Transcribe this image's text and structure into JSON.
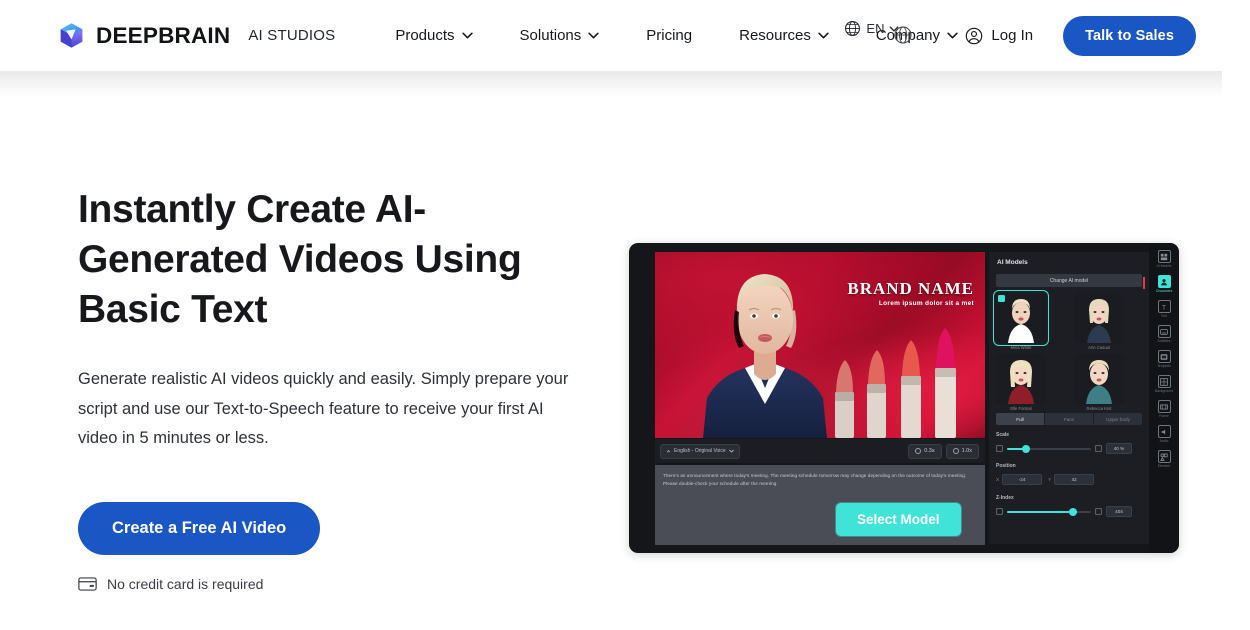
{
  "brand": {
    "logo_icon": "cube-logo-icon",
    "name": "DEEPBRAIN",
    "sub": "AI STUDIOS",
    "accent": "#1A56C4"
  },
  "nav": {
    "items": [
      {
        "label": "Products",
        "has_chevron": true,
        "icon": "chevron-down-icon"
      },
      {
        "label": "Solutions",
        "has_chevron": true,
        "icon": "chevron-down-icon"
      },
      {
        "label": "Pricing",
        "has_chevron": false,
        "icon": ""
      },
      {
        "label": "Resources",
        "has_chevron": true,
        "icon": "chevron-down-icon"
      },
      {
        "label": "Company",
        "has_chevron": true,
        "icon": "chevron-down-icon"
      }
    ]
  },
  "header_right": {
    "language": {
      "icon": "globe-icon",
      "label": "EN",
      "chevron": "chevron-down-icon"
    },
    "login": {
      "icon": "user-circle-icon",
      "label": "Log In"
    },
    "cta": {
      "label": "Talk to Sales",
      "color": "#1A56C4"
    }
  },
  "hero": {
    "title": "Instantly Create AI-Generated Videos Using Basic Text",
    "subtitle": "Generate realistic AI videos quickly and easily. Simply prepare your script and use our Text-to-Speech feature to receive your first AI video in 5 minutes or less.",
    "cta_label": "Create a Free AI Video",
    "note": {
      "icon": "credit-card-icon",
      "label": "No credit card is required"
    }
  },
  "preview": {
    "canvas": {
      "brand_name": "BRAND NAME",
      "brand_tagline": "Lorem ipsum dolor sit a met",
      "avatar_alt": "ai-presenter"
    },
    "toolbar": {
      "voice": {
        "icon": "voice-icon",
        "label": "English - Original Voice",
        "chevron": "chevron-down-icon"
      },
      "pause": {
        "icon": "clock-icon",
        "label": "0.3s"
      },
      "speed": {
        "icon": "speed-icon",
        "label": "1.0x"
      }
    },
    "script_text": "There's an announcement where today's meeting. The meeting schedule tomorrow may change depending on the outcome of today's meeting. Please double-check your schedule after the meeting.",
    "select_model_button": {
      "label": "Select Model",
      "color": "#3FE3D7"
    },
    "panel": {
      "title": "AI Models",
      "change_button": "Change AI model",
      "models": [
        {
          "name": "Mina White",
          "selected": true
        },
        {
          "name": "Ann Casual",
          "selected": false
        },
        {
          "name": "Elle Formal",
          "selected": false
        },
        {
          "name": "Rebecca Knit",
          "selected": false
        }
      ],
      "segments": [
        {
          "label": "Full",
          "active": true
        },
        {
          "label": "Face",
          "active": false
        },
        {
          "label": "Upper body",
          "active": false
        }
      ],
      "scale": {
        "label": "Scale",
        "value": "40 %",
        "percent": 22
      },
      "position": {
        "label": "Position",
        "x_label": "X",
        "x_value": "-24",
        "y_label": "Y",
        "y_value": "42"
      },
      "zindex": {
        "label": "Z-Index",
        "value": "404",
        "percent": 78
      }
    },
    "rail": [
      {
        "label": "AI Models",
        "icon": "ai-models-icon",
        "active": false
      },
      {
        "label": "Characters",
        "icon": "character-icon",
        "active": true
      },
      {
        "label": "Text",
        "icon": "text-icon",
        "active": false
      },
      {
        "label": "Subtitles",
        "icon": "subtitle-icon",
        "active": false
      },
      {
        "label": "Template",
        "icon": "template-icon",
        "active": false
      },
      {
        "label": "Background",
        "icon": "background-icon",
        "active": false
      },
      {
        "label": "Frame",
        "icon": "frame-icon",
        "active": false
      },
      {
        "label": "Audio",
        "icon": "audio-icon",
        "active": false
      },
      {
        "label": "Element",
        "icon": "element-icon",
        "active": false
      }
    ],
    "cursor": "mouse-pointer-icon"
  },
  "overlay_cursor": "crosshair-cursor-icon"
}
